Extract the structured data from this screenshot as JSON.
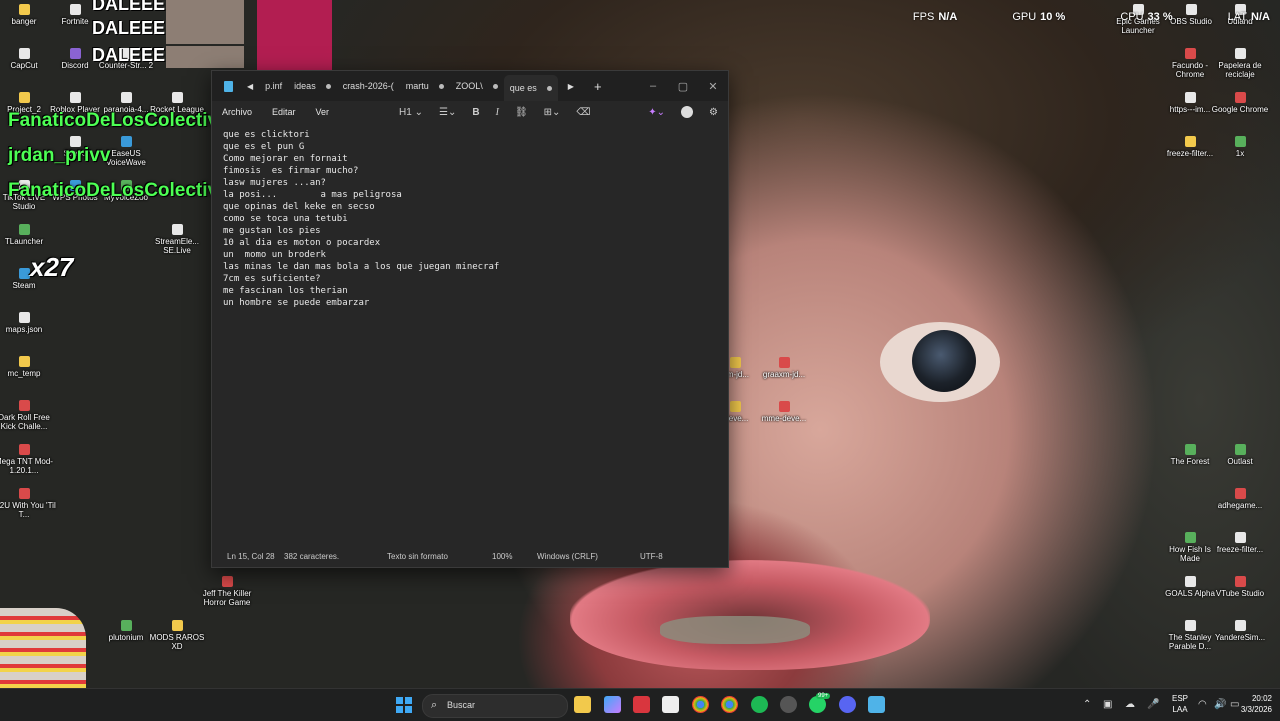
{
  "desktop_left": [
    {
      "label": "banger",
      "icon": "folder-icon",
      "kind": "folder"
    },
    {
      "label": "Fortnite",
      "icon": "fortnite-icon",
      "kind": "app"
    },
    {
      "label": "CapCut",
      "icon": "capcut-icon",
      "kind": "app"
    },
    {
      "label": "Discord",
      "icon": "discord-icon",
      "kind": "app5"
    },
    {
      "label": "Counter-Str... 2",
      "icon": "counter-strike-icon",
      "kind": "app"
    },
    {
      "label": "Project_2",
      "icon": "folder-icon",
      "kind": "folder"
    },
    {
      "label": "Roblox Player",
      "icon": "roblox-icon",
      "kind": "app"
    },
    {
      "label": "paranoia-4...",
      "icon": "file-icon",
      "kind": "app"
    },
    {
      "label": "Rocket League",
      "icon": "rocket-league-icon",
      "kind": "app"
    },
    {
      "label": "EaseUS VoiceWave",
      "icon": "easeus-icon",
      "kind": "app3"
    },
    {
      "label": "Studio",
      "icon": "studio-icon",
      "kind": "app"
    },
    {
      "label": "TikTok LIVE Studio",
      "icon": "tiktok-icon",
      "kind": "app"
    },
    {
      "label": "WPS Photos",
      "icon": "wps-photos-icon",
      "kind": "app3"
    },
    {
      "label": "MyVoiceZoo",
      "icon": "myvoicezoo-icon",
      "kind": "app4"
    },
    {
      "label": "TLauncher",
      "icon": "tlauncher-icon",
      "kind": "app4"
    },
    {
      "label": "StreamEle... SE.Live",
      "icon": "streamelements-icon",
      "kind": "app"
    },
    {
      "label": "Steam",
      "icon": "steam-icon",
      "kind": "app3"
    },
    {
      "label": "maps.json",
      "icon": "json-file-icon",
      "kind": "app"
    },
    {
      "label": "mc_temp",
      "icon": "folder-icon",
      "kind": "folder"
    },
    {
      "label": "Dark Roll Free Kick Challe...",
      "icon": "game-icon",
      "kind": "app2"
    },
    {
      "label": "Mega TNT Mod-1.20.1...",
      "icon": "mod-file-icon",
      "kind": "app2"
    },
    {
      "label": "AI2U With You 'Til T...",
      "icon": "game-icon",
      "kind": "app2"
    },
    {
      "label": "Jeff The Killer Horror Game",
      "icon": "game-icon",
      "kind": "app2"
    },
    {
      "label": "plutonium",
      "icon": "plutonium-icon",
      "kind": "app4"
    },
    {
      "label": "MODS RAROS XD",
      "icon": "folder-icon",
      "kind": "folder"
    }
  ],
  "desktop_right": [
    {
      "label": "Epic Games Launcher",
      "icon": "epic-games-icon",
      "kind": "app"
    },
    {
      "label": "OBS Studio",
      "icon": "obs-icon",
      "kind": "app"
    },
    {
      "label": "Udland",
      "icon": "udland-icon",
      "kind": "app"
    },
    {
      "label": "Facundo - Chrome",
      "icon": "chrome-icon",
      "kind": "app2"
    },
    {
      "label": "Papelera de reciclaje",
      "icon": "recycle-bin-icon",
      "kind": "app"
    },
    {
      "label": "https---im...",
      "icon": "link-icon",
      "kind": "app"
    },
    {
      "label": "Google Chrome",
      "icon": "chrome-icon",
      "kind": "app2"
    },
    {
      "label": "freeze-filter...",
      "icon": "folder-icon",
      "kind": "folder"
    },
    {
      "label": "1x",
      "icon": "app-icon",
      "kind": "app4"
    },
    {
      "label": "The Forest",
      "icon": "the-forest-icon",
      "kind": "app4"
    },
    {
      "label": "Outlast",
      "icon": "outlast-icon",
      "kind": "app4"
    },
    {
      "label": "adhegame...",
      "icon": "game-icon",
      "kind": "app2"
    },
    {
      "label": "How Fish Is Made",
      "icon": "game-icon",
      "kind": "app4"
    },
    {
      "label": "freeze-filter...",
      "icon": "file-icon",
      "kind": "app"
    },
    {
      "label": "GOALS Alpha",
      "icon": "goals-icon",
      "kind": "app"
    },
    {
      "label": "VTube Studio",
      "icon": "vtube-studio-icon",
      "kind": "app2"
    },
    {
      "label": "The Stanley Parable D...",
      "icon": "stanley-parable-icon",
      "kind": "app"
    },
    {
      "label": "YandereSim...",
      "icon": "yandere-icon",
      "kind": "app"
    }
  ],
  "desktop_middle": [
    {
      "label": "lvm-jd...",
      "icon": "folder-icon",
      "kind": "folder"
    },
    {
      "label": "graaxm-jd...",
      "icon": "chrome-icon",
      "kind": "app2"
    },
    {
      "label": "-deve...",
      "icon": "folder-icon",
      "kind": "folder"
    },
    {
      "label": "mme-deve...",
      "icon": "chrome-icon",
      "kind": "app2"
    }
  ],
  "stream_overlay": {
    "chat": [
      {
        "user": "FanaticoDeLosColectivos",
        "suffix": " :",
        "color": "green"
      },
      {
        "user": "jrdan_privv",
        "suffix": "",
        "color": "green"
      },
      {
        "user": "FanaticoDeLosColectivos",
        "suffix": ":",
        "color": "green"
      }
    ],
    "alerts": [
      "DALEEE",
      "DALEEE",
      "DALEEE"
    ],
    "multiplier": "x27"
  },
  "hud": {
    "fps_label": "FPS",
    "fps_value": "N/A",
    "gpu_label": "GPU",
    "gpu_value": "10 %",
    "cpu_label": "CPU",
    "cpu_value": "33 %",
    "lat_label": "LAT",
    "lat_value": "N/A"
  },
  "notepad": {
    "tabs": [
      {
        "label": "p.inf",
        "dot": false
      },
      {
        "label": "ideas",
        "dot": true
      },
      {
        "label": "crash-2026-(",
        "dot": false
      },
      {
        "label": "martu",
        "dot": true
      },
      {
        "label": "ZOOL\\",
        "dot": true
      },
      {
        "label": "que es",
        "dot": true,
        "active": true
      }
    ],
    "menu": [
      "Archivo",
      "Editar",
      "Ver"
    ],
    "heading": "H1",
    "lines": [
      "que es clicktori",
      "que es el pun G",
      "Como mejorar en fornait",
      "fimosis  es firmar mucho?",
      "lasw mujeres ...an?",
      "la posi...        a mas peligrosa",
      "que opinas del keke en secso",
      "como se toca una tetubi",
      "me gustan los pies",
      "10 al dia es moton o pocardex",
      "un  momo un broderk",
      "las minas le dan mas bola a los que juegan minecraf",
      "7cm es suficiente?",
      "me fascinan los therian",
      "un hombre se puede embarzar"
    ],
    "status": {
      "position": "Ln 15, Col 28",
      "chars": "382 caracteres.",
      "format": "Texto sin formato",
      "zoom": "100%",
      "line_ending": "Windows (CRLF)",
      "encoding": "UTF-8"
    }
  },
  "taskbar": {
    "search_placeholder": "Buscar",
    "whatsapp_badge": "99+",
    "lang_top": "ESP",
    "lang_bottom": "LAA",
    "time": "20:02",
    "date": "3/3/2026"
  }
}
